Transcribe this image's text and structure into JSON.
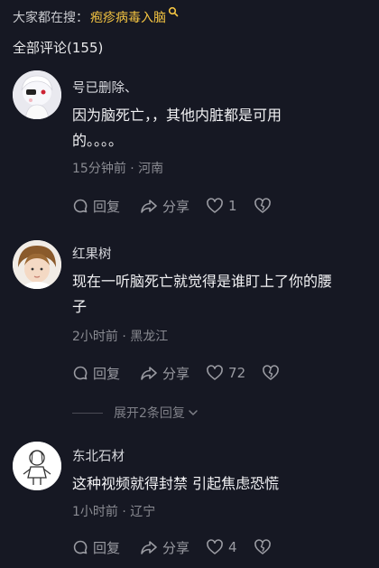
{
  "search": {
    "prefix": "大家都在搜：",
    "keyword": "疱疹病毒入脑"
  },
  "comments_header": {
    "title": "全部评论(155)"
  },
  "comments": [
    {
      "author": "号已删除、",
      "text_line1": "因为脑死亡，，其他内脏都是可用",
      "text_line2": "的。。。。",
      "meta": "15分钟前 · 河南",
      "reply_label": "回复",
      "share_label": "分享",
      "like_count": "1"
    },
    {
      "author": "红果树",
      "text_line1": "现在一听脑死亡就觉得是谁盯上了你的腰",
      "text_line2": "子",
      "meta": "2小时前 · 黑龙江",
      "reply_label": "回复",
      "share_label": "分享",
      "like_count": "72",
      "expand_label": "展开2条回复"
    },
    {
      "author": "东北石材",
      "text_line1": "这种视频就得封禁   引起焦虑恐慌",
      "meta": "1小时前 · 辽宁",
      "reply_label": "回复",
      "share_label": "分享",
      "like_count": "4"
    }
  ],
  "colors": {
    "background": "#161823",
    "keyword": "#f5c542",
    "muted": "#8a8b92"
  }
}
